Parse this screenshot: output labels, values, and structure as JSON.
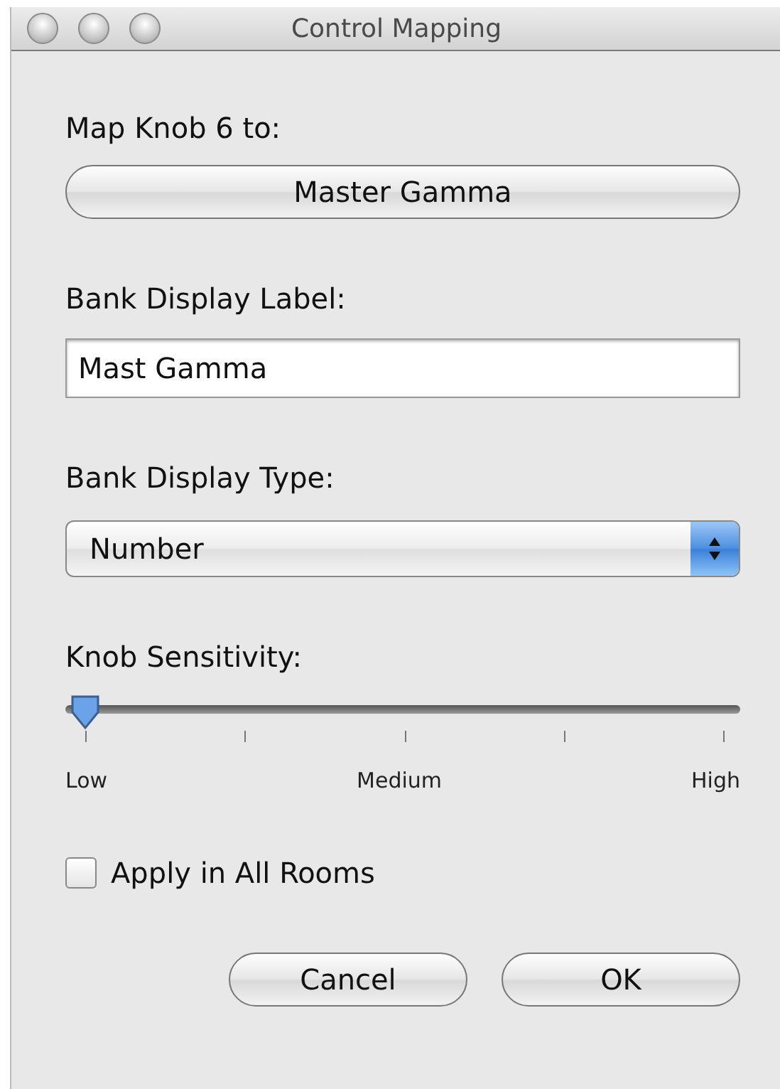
{
  "window": {
    "title": "Control Mapping"
  },
  "map": {
    "label": "Map Knob 6 to:",
    "button": "Master Gamma"
  },
  "display_label": {
    "label": "Bank Display Label:",
    "value": "Mast Gamma"
  },
  "display_type": {
    "label": "Bank Display Type:",
    "value": "Number"
  },
  "sensitivity": {
    "label": "Knob Sensitivity:",
    "level": 0,
    "ticks": [
      "Low",
      "Medium",
      "High"
    ]
  },
  "apply_all": {
    "label": "Apply in All Rooms",
    "checked": false
  },
  "buttons": [
    {
      "label": "Cancel"
    },
    {
      "label": "OK"
    }
  ]
}
